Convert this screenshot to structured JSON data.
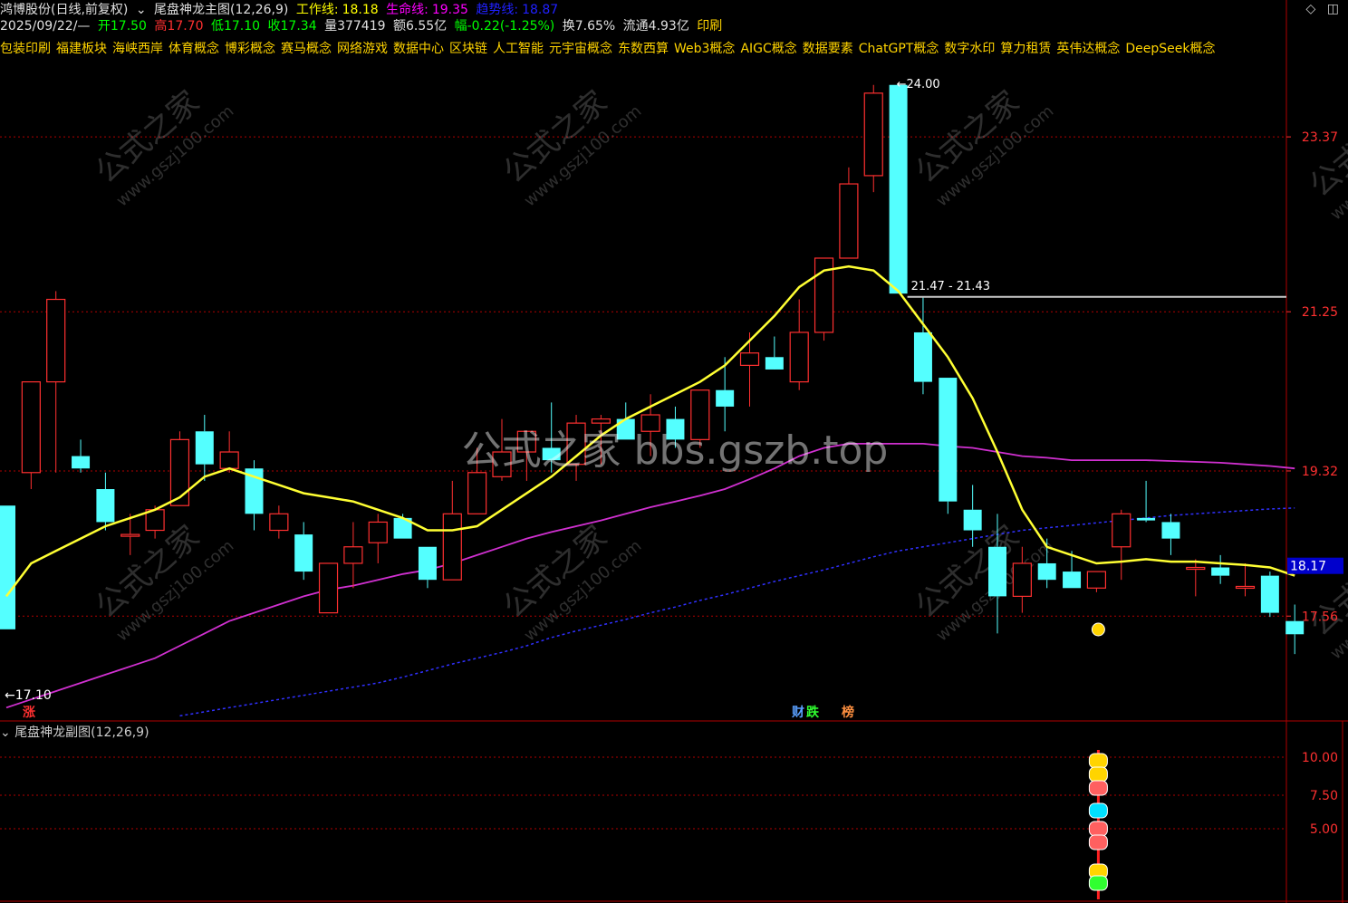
{
  "header": {
    "stock_name": "鸿博股份(日线,前复权)",
    "indicator_name": "尾盘神龙主图(12,26,9)",
    "work_line_label": "工作线:",
    "work_line_value": "18.18",
    "life_line_label": "生命线:",
    "life_line_value": "19.35",
    "trend_line_label": "趋势线:",
    "trend_line_value": "18.87",
    "date": "2025/09/22/—",
    "open_label": "开",
    "open_value": "17.50",
    "high_label": "高",
    "high_value": "17.70",
    "low_label": "低",
    "low_value": "17.10",
    "close_label": "收",
    "close_value": "17.34",
    "volume_label": "量",
    "volume_value": "377419",
    "amount_label": "额",
    "amount_value": "6.55亿",
    "change_label": "幅",
    "change_value": "-0.22(-1.25%)",
    "turnover_label": "换",
    "turnover_value": "7.65%",
    "float_label": "流通",
    "float_value": "4.93亿",
    "industry": "印刷"
  },
  "concepts": [
    "包装印刷",
    "福建板块",
    "海峡西岸",
    "体育概念",
    "博彩概念",
    "赛马概念",
    "网络游戏",
    "数据中心",
    "区块链",
    "人工智能",
    "元宇宙概念",
    "东数西算",
    "Web3概念",
    "AIGC概念",
    "数据要素",
    "ChatGPT概念",
    "数字水印",
    "算力租赁",
    "英伟达概念",
    "DeepSeek概念"
  ],
  "sub_chart": {
    "title": "尾盘神龙副图(12,26,9)",
    "ticks": [
      "10.00",
      "7.50",
      "5.00"
    ]
  },
  "watermark": {
    "center": "公式之家 bbs.gszb.top",
    "tile_line1": "公式之家",
    "tile_line2": "www.gszj100.com"
  },
  "colors": {
    "up": "#ff3030",
    "down": "#54ffff",
    "work_line": "#ffff33",
    "life_line": "#d030d0",
    "trend_line": "#3030ff",
    "grid": "#b00000",
    "axis_text": "#ff3030"
  },
  "chart_data": {
    "type": "candlestick",
    "y_ticks": [
      23.37,
      21.25,
      19.32,
      17.56
    ],
    "ylim": [
      16.3,
      24.7
    ],
    "current_price_label": "18.17",
    "high_marker": "24.00",
    "low_marker": "17.10",
    "range_label": "21.47 - 21.43",
    "signal_labels": {
      "zhang": "涨",
      "cai": "财",
      "die": "跌",
      "bang": "榜"
    },
    "candles": [
      {
        "o": 18.9,
        "h": 18.9,
        "l": 17.4,
        "c": 17.4
      },
      {
        "o": 19.3,
        "h": 20.2,
        "l": 19.1,
        "c": 20.4
      },
      {
        "o": 20.4,
        "h": 21.5,
        "l": 19.3,
        "c": 21.4
      },
      {
        "o": 19.5,
        "h": 19.7,
        "l": 19.3,
        "c": 19.35
      },
      {
        "o": 19.1,
        "h": 19.3,
        "l": 18.6,
        "c": 18.7
      },
      {
        "o": 18.55,
        "h": 18.8,
        "l": 18.3,
        "c": 18.55
      },
      {
        "o": 18.6,
        "h": 18.9,
        "l": 18.5,
        "c": 18.85
      },
      {
        "o": 18.9,
        "h": 19.8,
        "l": 18.9,
        "c": 19.7
      },
      {
        "o": 19.8,
        "h": 20.0,
        "l": 19.2,
        "c": 19.4
      },
      {
        "o": 19.35,
        "h": 19.8,
        "l": 19.3,
        "c": 19.55
      },
      {
        "o": 19.35,
        "h": 19.45,
        "l": 18.6,
        "c": 18.8
      },
      {
        "o": 18.6,
        "h": 18.9,
        "l": 18.5,
        "c": 18.8
      },
      {
        "o": 18.55,
        "h": 18.7,
        "l": 18.0,
        "c": 18.1
      },
      {
        "o": 17.6,
        "h": 18.2,
        "l": 17.6,
        "c": 18.2
      },
      {
        "o": 18.2,
        "h": 18.7,
        "l": 17.9,
        "c": 18.4
      },
      {
        "o": 18.45,
        "h": 18.8,
        "l": 18.2,
        "c": 18.7
      },
      {
        "o": 18.75,
        "h": 18.8,
        "l": 18.5,
        "c": 18.5
      },
      {
        "o": 18.4,
        "h": 18.4,
        "l": 17.9,
        "c": 18.0
      },
      {
        "o": 18.0,
        "h": 19.2,
        "l": 18.0,
        "c": 18.8
      },
      {
        "o": 18.8,
        "h": 19.6,
        "l": 18.8,
        "c": 19.3
      },
      {
        "o": 19.25,
        "h": 19.95,
        "l": 19.2,
        "c": 19.55
      },
      {
        "o": 19.55,
        "h": 19.8,
        "l": 19.2,
        "c": 19.8
      },
      {
        "o": 19.6,
        "h": 20.15,
        "l": 19.3,
        "c": 19.45
      },
      {
        "o": 19.4,
        "h": 20.0,
        "l": 19.2,
        "c": 19.9
      },
      {
        "o": 19.9,
        "h": 20.0,
        "l": 19.4,
        "c": 19.95
      },
      {
        "o": 19.95,
        "h": 20.15,
        "l": 19.7,
        "c": 19.7
      },
      {
        "o": 19.8,
        "h": 20.25,
        "l": 19.5,
        "c": 20.0
      },
      {
        "o": 19.95,
        "h": 20.1,
        "l": 19.6,
        "c": 19.7
      },
      {
        "o": 19.7,
        "h": 20.3,
        "l": 19.6,
        "c": 20.3
      },
      {
        "o": 20.3,
        "h": 20.7,
        "l": 19.8,
        "c": 20.1
      },
      {
        "o": 20.6,
        "h": 21.0,
        "l": 20.1,
        "c": 20.75
      },
      {
        "o": 20.7,
        "h": 20.95,
        "l": 20.6,
        "c": 20.55
      },
      {
        "o": 20.4,
        "h": 21.4,
        "l": 20.3,
        "c": 21.0
      },
      {
        "o": 21.0,
        "h": 21.5,
        "l": 20.9,
        "c": 21.9
      },
      {
        "o": 21.9,
        "h": 23.0,
        "l": 21.9,
        "c": 22.8
      },
      {
        "o": 22.9,
        "h": 24.0,
        "l": 22.7,
        "c": 23.9
      },
      {
        "o": 24.0,
        "h": 24.0,
        "l": 21.47,
        "c": 21.47
      },
      {
        "o": 21.0,
        "h": 21.43,
        "l": 20.25,
        "c": 20.4
      },
      {
        "o": 20.45,
        "h": 20.45,
        "l": 18.8,
        "c": 18.95
      },
      {
        "o": 18.85,
        "h": 19.15,
        "l": 18.4,
        "c": 18.6
      },
      {
        "o": 18.4,
        "h": 18.8,
        "l": 17.35,
        "c": 17.8
      },
      {
        "o": 17.8,
        "h": 18.4,
        "l": 17.6,
        "c": 18.2
      },
      {
        "o": 18.2,
        "h": 18.5,
        "l": 17.9,
        "c": 18.0
      },
      {
        "o": 18.1,
        "h": 18.35,
        "l": 17.9,
        "c": 17.9
      },
      {
        "o": 17.9,
        "h": 18.1,
        "l": 17.85,
        "c": 18.1
      },
      {
        "o": 18.4,
        "h": 18.85,
        "l": 18.0,
        "c": 18.8
      },
      {
        "o": 18.75,
        "h": 19.2,
        "l": 18.7,
        "c": 18.72
      },
      {
        "o": 18.7,
        "h": 18.8,
        "l": 18.3,
        "c": 18.5
      },
      {
        "o": 18.15,
        "h": 18.25,
        "l": 17.8,
        "c": 18.15
      },
      {
        "o": 18.15,
        "h": 18.3,
        "l": 17.95,
        "c": 18.05
      },
      {
        "o": 17.9,
        "h": 18.2,
        "l": 17.8,
        "c": 17.92
      },
      {
        "o": 18.05,
        "h": 18.1,
        "l": 17.55,
        "c": 17.6
      },
      {
        "o": 17.5,
        "h": 17.7,
        "l": 17.1,
        "c": 17.34
      }
    ],
    "work_line": [
      17.8,
      18.2,
      18.35,
      18.5,
      18.65,
      18.75,
      18.85,
      19.0,
      19.25,
      19.35,
      19.25,
      19.15,
      19.05,
      19.0,
      18.95,
      18.85,
      18.75,
      18.6,
      18.6,
      18.65,
      18.85,
      19.05,
      19.25,
      19.5,
      19.75,
      19.95,
      20.1,
      20.25,
      20.4,
      20.6,
      20.9,
      21.2,
      21.55,
      21.75,
      21.8,
      21.75,
      21.5,
      21.1,
      20.7,
      20.2,
      19.55,
      18.85,
      18.4,
      18.3,
      18.2,
      18.22,
      18.25,
      18.22,
      18.22,
      18.2,
      18.18,
      18.15,
      18.05
    ],
    "life_line": [
      16.45,
      16.55,
      16.65,
      16.75,
      16.85,
      16.95,
      17.05,
      17.2,
      17.35,
      17.5,
      17.6,
      17.7,
      17.8,
      17.88,
      17.93,
      18.0,
      18.07,
      18.12,
      18.2,
      18.3,
      18.4,
      18.5,
      18.58,
      18.65,
      18.72,
      18.8,
      18.88,
      18.95,
      19.02,
      19.1,
      19.22,
      19.35,
      19.5,
      19.6,
      19.65,
      19.65,
      19.65,
      19.65,
      19.62,
      19.6,
      19.55,
      19.5,
      19.48,
      19.45,
      19.45,
      19.45,
      19.45,
      19.44,
      19.43,
      19.42,
      19.4,
      19.38,
      19.35
    ],
    "trend_line": [
      null,
      null,
      null,
      null,
      null,
      null,
      null,
      16.35,
      16.4,
      16.45,
      16.5,
      16.55,
      16.6,
      16.65,
      16.7,
      16.75,
      16.82,
      16.9,
      16.98,
      17.05,
      17.12,
      17.2,
      17.3,
      17.38,
      17.45,
      17.52,
      17.6,
      17.67,
      17.75,
      17.82,
      17.9,
      17.98,
      18.05,
      18.12,
      18.2,
      18.28,
      18.35,
      18.4,
      18.45,
      18.5,
      18.55,
      18.6,
      18.63,
      18.66,
      18.69,
      18.72,
      18.75,
      18.78,
      18.8,
      18.82,
      18.84,
      18.86,
      18.87
    ]
  }
}
